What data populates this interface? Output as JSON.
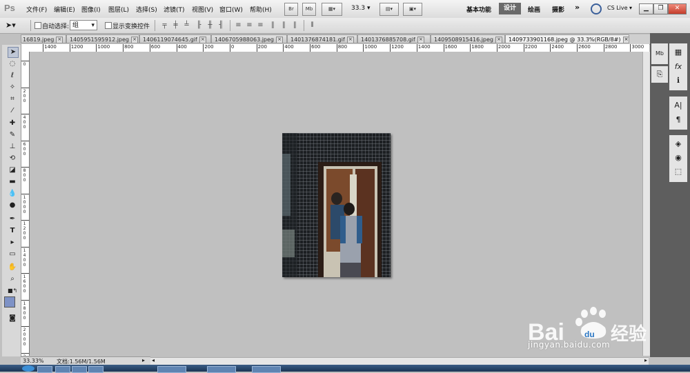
{
  "app": {
    "logo": "Ps"
  },
  "menu": [
    "文件(F)",
    "编辑(E)",
    "图像(I)",
    "图层(L)",
    "选择(S)",
    "滤镜(T)",
    "视图(V)",
    "窗口(W)",
    "帮助(H)"
  ],
  "menubar_buttons": {
    "bridge": "Br",
    "minibridge": "Mb",
    "zoom": "33.3"
  },
  "workspaces": {
    "basic": "基本功能",
    "design": "设计",
    "painting": "绘画",
    "photography": "摄影",
    "more": "»",
    "cslive": "CS Live"
  },
  "options": {
    "auto_select_label": "自动选择:",
    "group_value": "组",
    "show_transform_label": "显示变换控件"
  },
  "tabs": [
    {
      "label": "16819.jpeg",
      "active": false
    },
    {
      "label": "1405951595912.jpeg",
      "active": false
    },
    {
      "label": "1406119074645.gif",
      "active": false
    },
    {
      "label": "1406705988063.jpeg",
      "active": false
    },
    {
      "label": "1401376874181.gif",
      "active": false
    },
    {
      "label": "1401376885708.gif",
      "active": false
    },
    {
      "label": "1409508915416.jpeg",
      "active": false
    },
    {
      "label": "1409733901168.jpeg @ 33.3%(RGB/8#)",
      "active": true
    }
  ],
  "ruler_h": [
    "1400",
    "1200",
    "1000",
    "800",
    "600",
    "400",
    "200",
    "0",
    "200",
    "400",
    "600",
    "800",
    "1000",
    "1200",
    "1400",
    "1600",
    "1800",
    "2000",
    "2200",
    "2400",
    "2600",
    "2800",
    "3000"
  ],
  "ruler_v": [
    "0",
    "200",
    "400",
    "600",
    "800",
    "1000",
    "1200",
    "1400",
    "1600",
    "1800",
    "2000",
    "2200"
  ],
  "status": {
    "zoom": "33.33%",
    "doc": "文档:1.56M/1.56M"
  },
  "watermark": {
    "url": "jingyan.baidu.com",
    "brand": "Bai",
    "brand2": "du",
    "cn": "经验"
  },
  "colors": {
    "foreground": "#7e92c6",
    "canvas_bg": "#c0c0c0",
    "design_ws": "#6a6a6a"
  }
}
